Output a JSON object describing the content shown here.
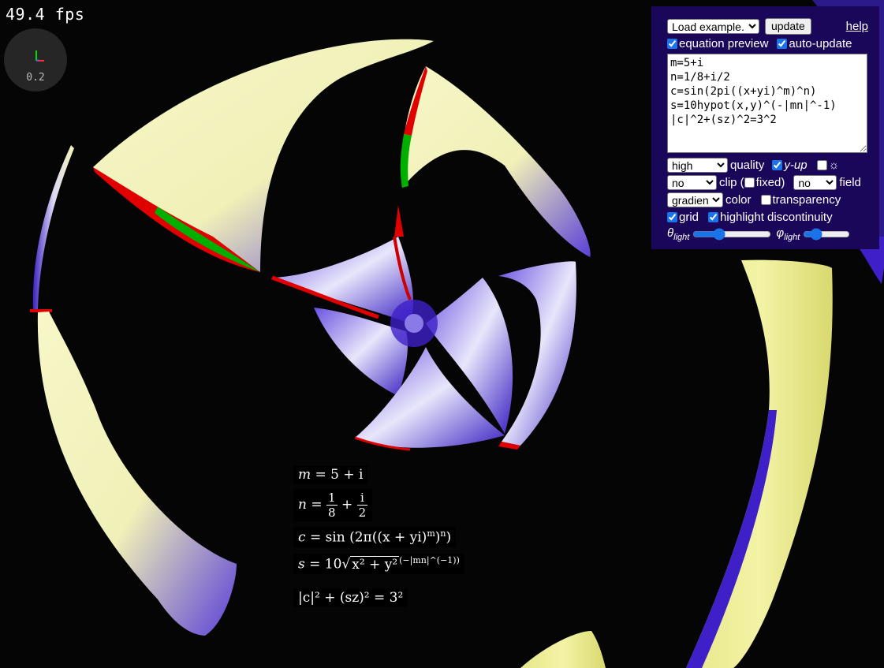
{
  "fps_text": "49.4 fps",
  "axes": {
    "scale_label": "0.2"
  },
  "panel": {
    "example_select": "Load example...",
    "update_label": "update",
    "help_label": "help",
    "equation_preview_label": "equation preview",
    "equation_preview_checked": true,
    "auto_update_label": "auto-update",
    "auto_update_checked": true,
    "equation_text": "m=5+i\nn=1/8+i/2\nc=sin(2pi((x+yi)^m)^n)\ns=10hypot(x,y)^(-|mn|^-1)\n|c|^2+(sz)^2=3^2",
    "quality_select": "high",
    "quality_label": "quality",
    "y_up_label": "y-up",
    "y_up_checked": true,
    "sun_label": "☼",
    "sun_checked": false,
    "clip_select": "no",
    "clip_label": "clip (",
    "fixed_label": "fixed)",
    "fixed_checked": false,
    "field_select": "no",
    "field_label": "field",
    "color_select": "gradient",
    "color_label": "color",
    "transparency_label": "transparency",
    "transparency_checked": false,
    "grid_label": "grid",
    "grid_checked": true,
    "highlight_label": "highlight discontinuity",
    "highlight_checked": true,
    "theta_symbol": "θ",
    "theta_sub": "light",
    "theta_value": 0.3,
    "phi_symbol": "φ",
    "phi_sub": "light",
    "phi_value": 0.2
  },
  "equation_preview": {
    "eq1": {
      "lhs": "m",
      "rhs": "= 5 + i"
    },
    "eq2": {
      "lhs": "n",
      "eq": "=",
      "num1": "1",
      "den1": "8",
      "plus": "+",
      "num2": "i",
      "den2": "2"
    },
    "eq3": {
      "lhs": "c",
      "rhs": "= sin (2π((x + yi)",
      "sup1": "m",
      "mid": ")",
      "sup2": "n",
      "end": ")"
    },
    "eq4": {
      "lhs": "s",
      "rhs": "= 10",
      "radicand": "x² + y²",
      "exponent": "(−|mn|^(−1))"
    },
    "eq5": {
      "text": "|c|² + (sz)² = 3²"
    }
  },
  "colors": {
    "panel_bg": "#1a075a",
    "surface_yellow": "#f4f4b0",
    "surface_blue": "#3f20c8",
    "discontinuity_red": "#e00000",
    "discontinuity_green": "#00b000"
  }
}
